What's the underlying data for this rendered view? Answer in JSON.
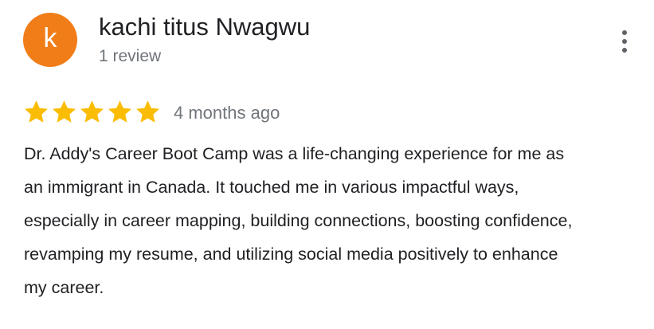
{
  "reviewer": {
    "avatar_letter": "k",
    "avatar_color": "#f17d19",
    "name": "kachi titus Nwagwu",
    "review_count": "1 review"
  },
  "menu": {
    "icon": "more-vert-icon"
  },
  "review": {
    "rating": 5,
    "max_rating": 5,
    "star_color": "#fbbc04",
    "date": "4 months ago",
    "text_lines": [
      "Dr. Addy's Career Boot Camp was a life-changing experience for me as",
      "an immigrant in Canada. It touched me in various impactful ways,",
      "especially in career mapping, building connections, boosting confidence,",
      "revamping my resume, and utilizing social media positively to enhance",
      "my career."
    ]
  }
}
